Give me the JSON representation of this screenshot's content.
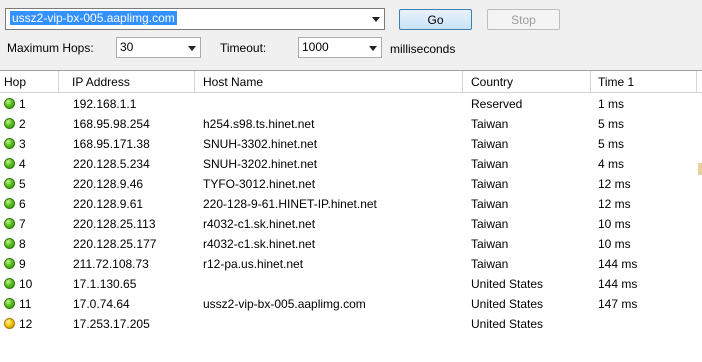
{
  "toolbar": {
    "url": "ussz2-vip-bx-005.aaplimg.com",
    "go_label": "Go",
    "stop_label": "Stop",
    "max_hops_label": "Maximum Hops:",
    "max_hops_value": "30",
    "timeout_label": "Timeout:",
    "timeout_value": "1000",
    "timeout_unit": "milliseconds"
  },
  "table": {
    "columns": [
      "Hop",
      "IP Address",
      "Host Name",
      "Country",
      "Time 1"
    ],
    "rows": [
      {
        "hop": "1",
        "status": "green",
        "ip": "192.168.1.1",
        "host": "",
        "country": "Reserved",
        "time": "1 ms"
      },
      {
        "hop": "2",
        "status": "green",
        "ip": "168.95.98.254",
        "host": "h254.s98.ts.hinet.net",
        "country": "Taiwan",
        "time": "5 ms"
      },
      {
        "hop": "3",
        "status": "green",
        "ip": "168.95.171.38",
        "host": "SNUH-3302.hinet.net",
        "country": "Taiwan",
        "time": "5 ms"
      },
      {
        "hop": "4",
        "status": "green",
        "ip": "220.128.5.234",
        "host": "SNUH-3202.hinet.net",
        "country": "Taiwan",
        "time": "4 ms"
      },
      {
        "hop": "5",
        "status": "green",
        "ip": "220.128.9.46",
        "host": "TYFO-3012.hinet.net",
        "country": "Taiwan",
        "time": "12 ms"
      },
      {
        "hop": "6",
        "status": "green",
        "ip": "220.128.9.61",
        "host": "220-128-9-61.HINET-IP.hinet.net",
        "country": "Taiwan",
        "time": "12 ms"
      },
      {
        "hop": "7",
        "status": "green",
        "ip": "220.128.25.113",
        "host": "r4032-c1.sk.hinet.net",
        "country": "Taiwan",
        "time": "10 ms"
      },
      {
        "hop": "8",
        "status": "green",
        "ip": "220.128.25.177",
        "host": "r4032-c1.sk.hinet.net",
        "country": "Taiwan",
        "time": "10 ms"
      },
      {
        "hop": "9",
        "status": "green",
        "ip": "211.72.108.73",
        "host": "r12-pa.us.hinet.net",
        "country": "Taiwan",
        "time": "144 ms"
      },
      {
        "hop": "10",
        "status": "green",
        "ip": "17.1.130.65",
        "host": "",
        "country": "United States",
        "time": "144 ms"
      },
      {
        "hop": "11",
        "status": "green",
        "ip": "17.0.74.64",
        "host": "ussz2-vip-bx-005.aaplimg.com",
        "country": "United States",
        "time": "147 ms"
      },
      {
        "hop": "12",
        "status": "yellow",
        "ip": "17.253.17.205",
        "host": "",
        "country": "United States",
        "time": ""
      }
    ]
  }
}
